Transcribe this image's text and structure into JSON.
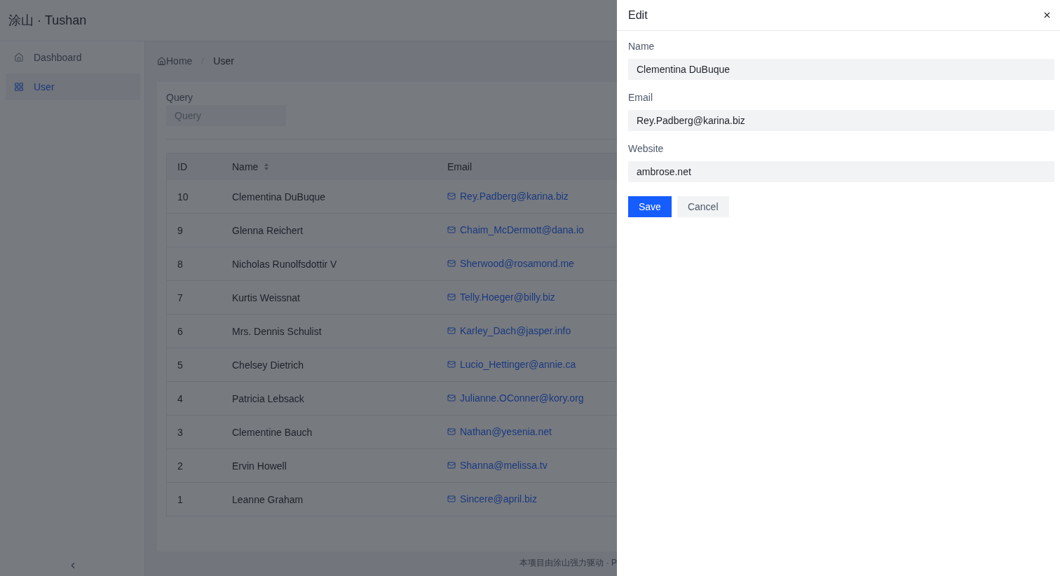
{
  "app_title": "涂山 · Tushan",
  "sidebar": {
    "items": [
      {
        "label": "Dashboard",
        "kind": "home",
        "selected": false
      },
      {
        "label": "User",
        "kind": "grid",
        "selected": true
      }
    ]
  },
  "breadcrumb": [
    "Home",
    "User"
  ],
  "filter": {
    "label": "Query",
    "placeholder": "Query"
  },
  "table": {
    "columns": [
      {
        "label": "ID",
        "sortable": false
      },
      {
        "label": "Name",
        "sortable": true
      },
      {
        "label": "Email",
        "sortable": false
      }
    ],
    "rows": [
      [
        "10",
        "Clementina DuBuque",
        "Rey.Padberg@karina.biz"
      ],
      [
        "9",
        "Glenna Reichert",
        "Chaim_McDermott@dana.io"
      ],
      [
        "8",
        "Nicholas Runolfsdottir V",
        "Sherwood@rosamond.me"
      ],
      [
        "7",
        "Kurtis Weissnat",
        "Telly.Hoeger@billy.biz"
      ],
      [
        "6",
        "Mrs. Dennis Schulist",
        "Karley_Dach@jasper.info"
      ],
      [
        "5",
        "Chelsey Dietrich",
        "Lucio_Hettinger@annie.ca"
      ],
      [
        "4",
        "Patricia Lebsack",
        "Julianne.OConner@kory.org"
      ],
      [
        "3",
        "Clementine Bauch",
        "Nathan@yesenia.net"
      ],
      [
        "2",
        "Ervin Howell",
        "Shanna@melissa.tv"
      ],
      [
        "1",
        "Leanne Graham",
        "Sincere@april.biz"
      ]
    ]
  },
  "footer": "本项目由涂山强力驱动 · P",
  "drawer": {
    "title": "Edit",
    "fields": [
      {
        "label": "Name",
        "value": "Clementina DuBuque"
      },
      {
        "label": "Email",
        "value": "Rey.Padberg@karina.biz"
      },
      {
        "label": "Website",
        "value": "ambrose.net"
      }
    ],
    "buttons": [
      {
        "label": "Save",
        "kind": "primary"
      },
      {
        "label": "Cancel",
        "kind": "secondary"
      }
    ]
  }
}
